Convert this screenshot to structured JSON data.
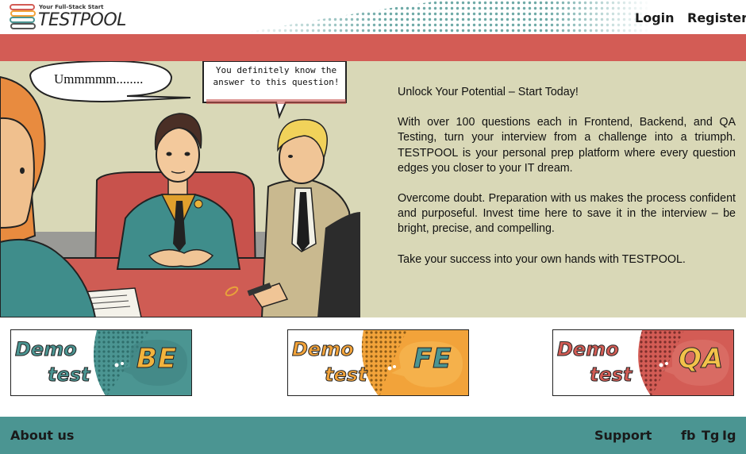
{
  "header": {
    "logo_tagline": "Your Full-Stack Start",
    "logo_name": "TESTPOOL",
    "nav": {
      "login": "Login",
      "register": "Register"
    }
  },
  "hero": {
    "bubble_left": "Ummmmm........",
    "bubble_right": "You definitely know the answer to this question!",
    "headline": "Unlock Your Potential – Start Today!",
    "paragraph_1": "With over 100 questions each in Frontend, Backend, and QA Testing, turn your interview from a challenge into a triumph. TESTPOOL is your personal prep platform where every question edges you closer to your IT dream.",
    "paragraph_2": "Overcome doubt. Preparation with us makes the process confident and purposeful. Invest time here to save it in the interview – be bright, precise, and compelling.",
    "paragraph_3": "Take your success into your own hands with TESTPOOL."
  },
  "demo_cards": [
    {
      "demo": "Demo",
      "test": "test",
      "code": "BE",
      "accent": "#4b9592",
      "text_color": "#4b9592",
      "code_color": "#f2b33d"
    },
    {
      "demo": "Demo",
      "test": "test",
      "code": "FE",
      "accent": "#f2a33a",
      "text_color": "#f2a33a",
      "code_color": "#4b9592"
    },
    {
      "demo": "Demo",
      "test": "test",
      "code": "QA",
      "accent": "#d35c55",
      "text_color": "#d35c55",
      "code_color": "#f2c24a"
    }
  ],
  "footer": {
    "about": "About us",
    "support": "Support",
    "social": {
      "fb": "fb",
      "tg": "Tg",
      "ig": "Ig"
    }
  },
  "colors": {
    "red": "#d35c55",
    "teal": "#4b9592",
    "orange": "#f2a33a",
    "hero_bg": "#d9d8b7"
  }
}
